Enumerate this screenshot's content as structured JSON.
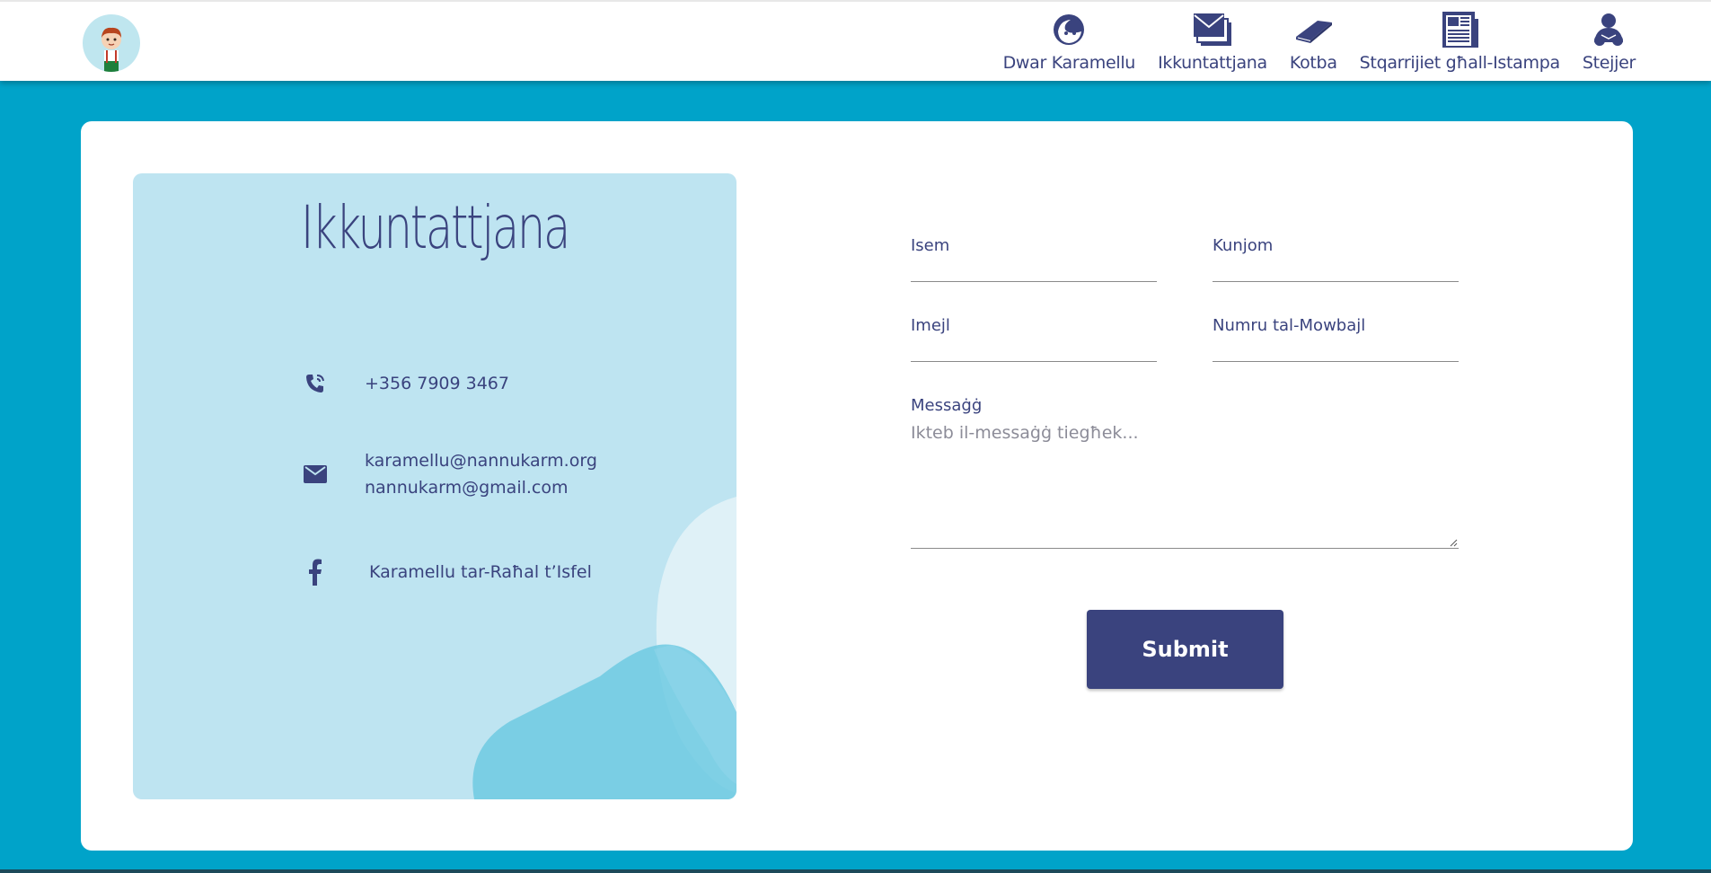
{
  "header": {
    "logo_icon": "boy-character-avatar",
    "nav": [
      {
        "label": "Dwar Karamellu",
        "icon": "face-icon"
      },
      {
        "label": "Ikkuntattjana",
        "icon": "envelopes-icon"
      },
      {
        "label": "Kotba",
        "icon": "book-icon"
      },
      {
        "label": "Stqarrijiet għall-Istampa",
        "icon": "newspaper-icon"
      },
      {
        "label": "Stejjer",
        "icon": "reader-icon"
      }
    ]
  },
  "contact": {
    "title": "Ikkuntattjana",
    "phone": "+356 7909 3467",
    "email_1": "karamellu@nannukarm.org",
    "email_2": "nannukarm@gmail.com",
    "facebook": "Karamellu tar-Raħal t’Isfel"
  },
  "form": {
    "first_name_label": "Isem",
    "first_name_value": "",
    "surname_label": "Kunjom",
    "surname_value": "",
    "email_label": "Imejl",
    "email_value": "",
    "mobile_label": "Numru tal-Mowbajl",
    "mobile_value": "",
    "message_label": "Messaġġ",
    "message_placeholder": "Ikteb il-messaġġ tiegħek...",
    "submit_label": "Submit"
  },
  "colors": {
    "background": "#00a3c9",
    "navy": "#3a437e",
    "panel": "#bee4f1"
  }
}
